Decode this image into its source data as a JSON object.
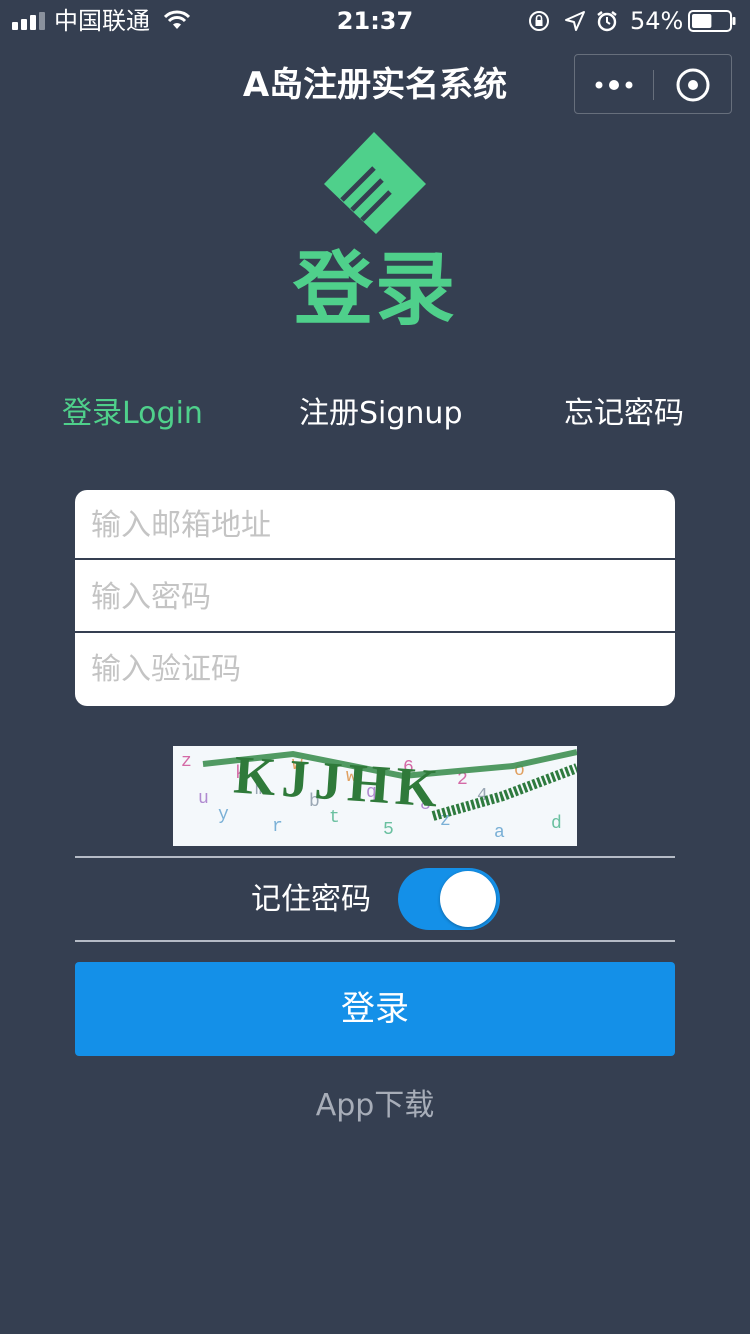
{
  "status_bar": {
    "carrier": "中国联通",
    "time": "21:37",
    "battery_percent": "54%",
    "battery_level": 0.54
  },
  "nav": {
    "title": "A岛注册实名系统"
  },
  "header": {
    "headline": "登录",
    "logo_color": "#4fd08b"
  },
  "tabs": [
    {
      "label": "登录Login",
      "active": true
    },
    {
      "label": "注册Signup",
      "active": false
    },
    {
      "label": "忘记密码",
      "active": false
    }
  ],
  "form": {
    "email_placeholder": "输入邮箱地址",
    "password_placeholder": "输入密码",
    "captcha_placeholder": "输入验证码"
  },
  "captcha": {
    "text": "KJJHK",
    "noise": "z y m w t q 6 z 4 o d u k r b w 5 8 2 a"
  },
  "remember": {
    "label": "记住密码",
    "enabled": true
  },
  "login_button": {
    "label": "登录"
  },
  "footer": {
    "app_download": "App下载"
  },
  "colors": {
    "background": "#353f51",
    "accent_green": "#4fd08b",
    "primary_blue": "#1490e8"
  }
}
